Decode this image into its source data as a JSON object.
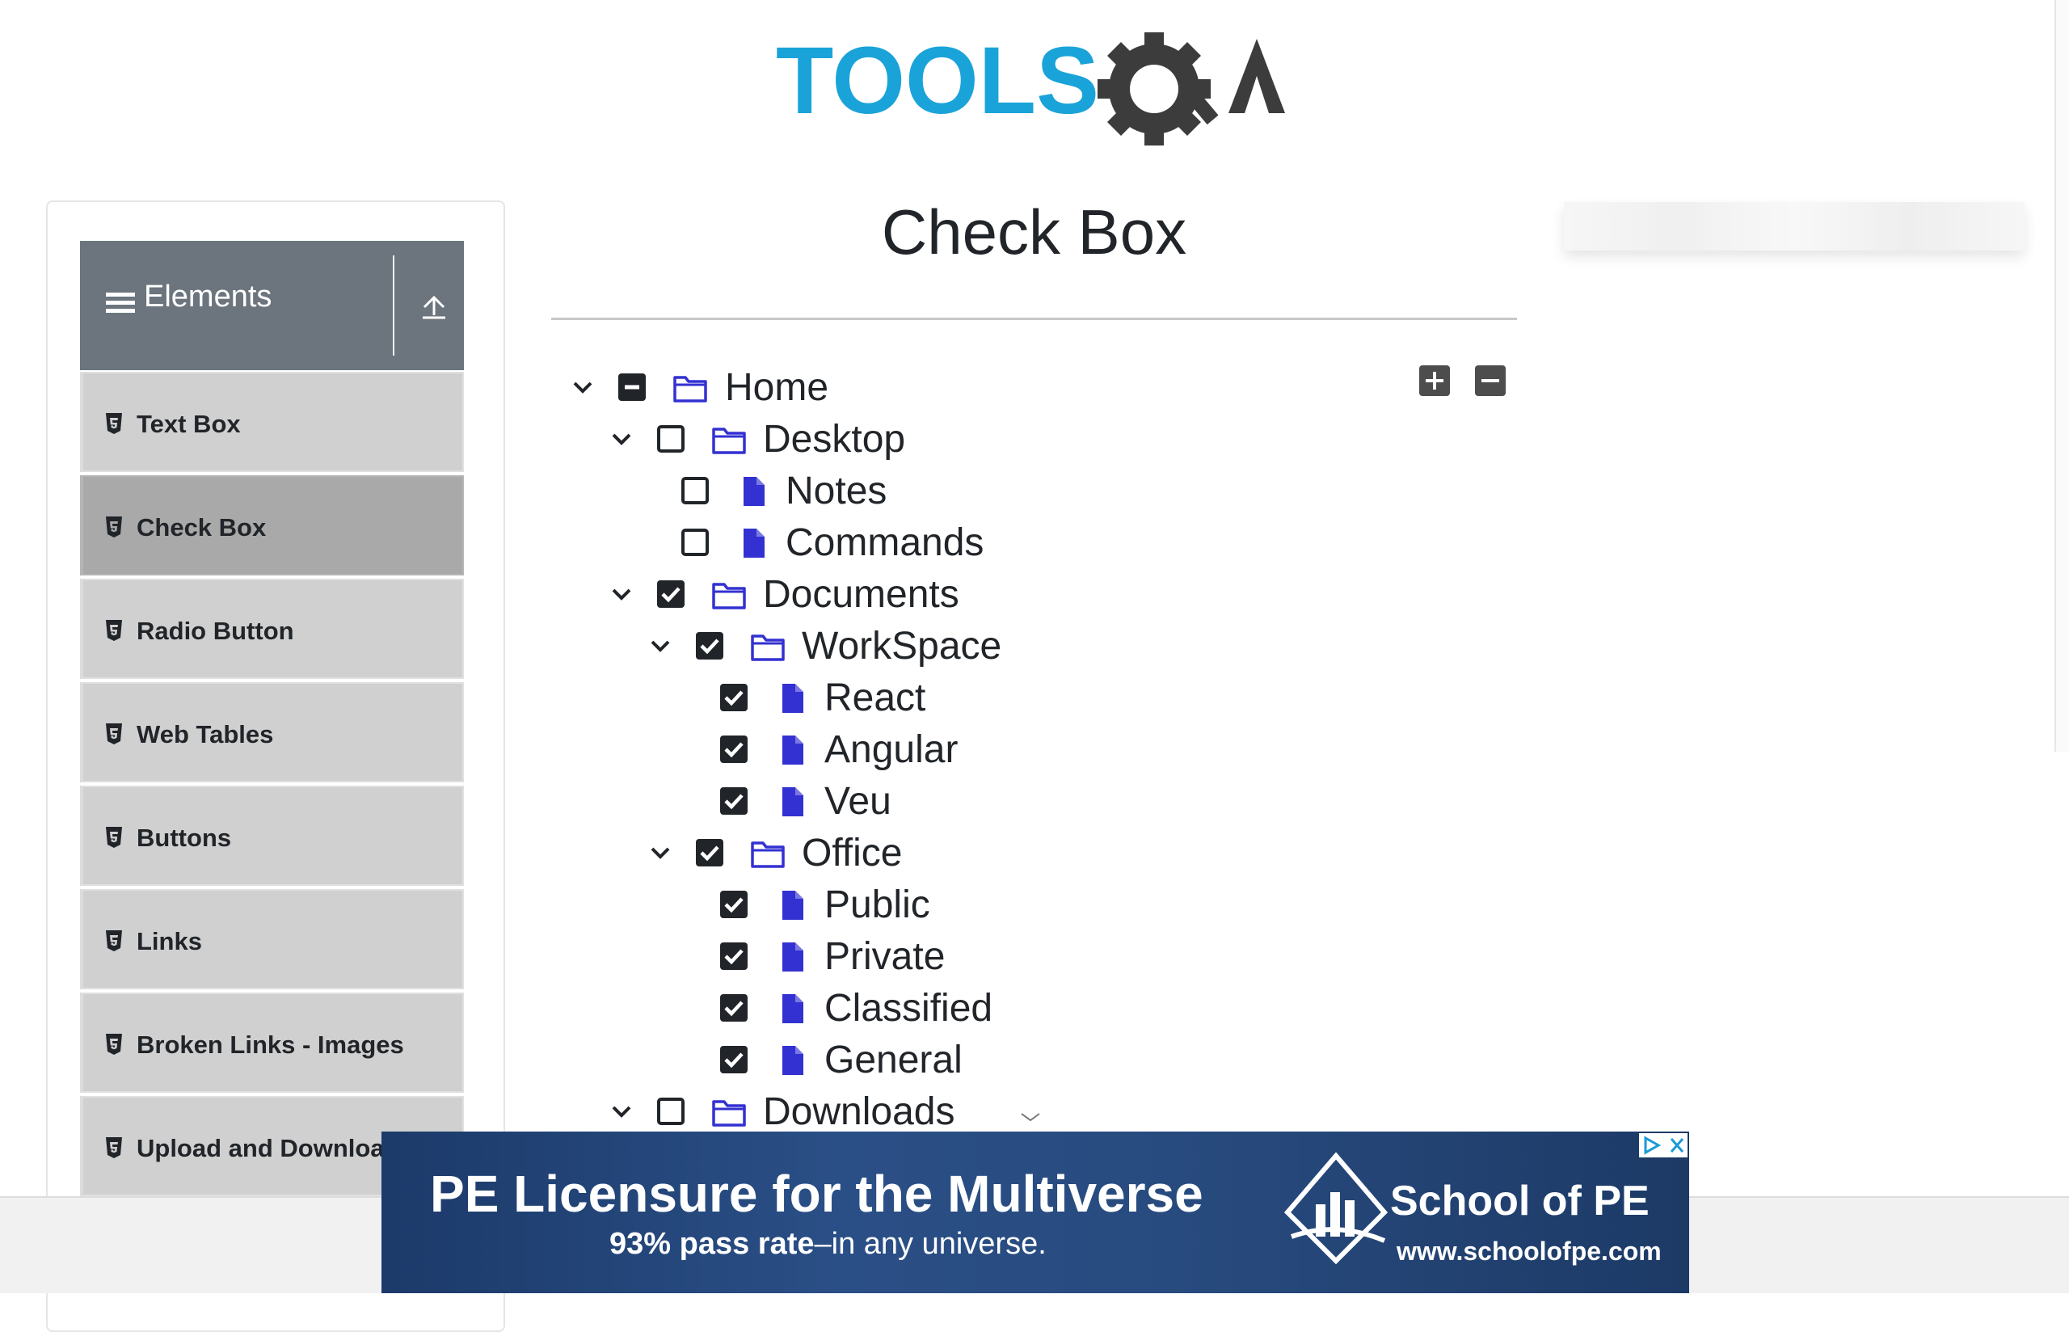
{
  "header": {
    "logo_alt": "TOOLSQA"
  },
  "sidebar": {
    "group_label": "Elements",
    "items": [
      {
        "label": "Text Box",
        "active": false
      },
      {
        "label": "Check Box",
        "active": true
      },
      {
        "label": "Radio Button",
        "active": false
      },
      {
        "label": "Web Tables",
        "active": false
      },
      {
        "label": "Buttons",
        "active": false
      },
      {
        "label": "Links",
        "active": false
      },
      {
        "label": "Broken Links - Images",
        "active": false
      },
      {
        "label": "Upload and Download",
        "active": false
      }
    ]
  },
  "main": {
    "title": "Check Box",
    "tree": [
      {
        "label": "Home",
        "state": "half",
        "type": "folder",
        "expanded": true
      },
      {
        "label": "Desktop",
        "state": "unchecked",
        "type": "folder",
        "expanded": true
      },
      {
        "label": "Notes",
        "state": "unchecked",
        "type": "file"
      },
      {
        "label": "Commands",
        "state": "unchecked",
        "type": "file"
      },
      {
        "label": "Documents",
        "state": "checked",
        "type": "folder",
        "expanded": true
      },
      {
        "label": "WorkSpace",
        "state": "checked",
        "type": "folder",
        "expanded": true
      },
      {
        "label": "React",
        "state": "checked",
        "type": "file"
      },
      {
        "label": "Angular",
        "state": "checked",
        "type": "file"
      },
      {
        "label": "Veu",
        "state": "checked",
        "type": "file"
      },
      {
        "label": "Office",
        "state": "checked",
        "type": "folder",
        "expanded": true
      },
      {
        "label": "Public",
        "state": "checked",
        "type": "file"
      },
      {
        "label": "Private",
        "state": "checked",
        "type": "file"
      },
      {
        "label": "Classified",
        "state": "checked",
        "type": "file"
      },
      {
        "label": "General",
        "state": "checked",
        "type": "file"
      },
      {
        "label": "Downloads",
        "state": "unchecked",
        "type": "folder",
        "expanded": true
      }
    ]
  },
  "ad": {
    "headline": "PE Licensure for the Multiverse",
    "sub_bold": "93% pass rate",
    "sub_rest": "–in any universe.",
    "brand": "School of PE",
    "url": "www.schoolofpe.com"
  },
  "colors": {
    "sidebar_header": "#6c757d",
    "menu_item": "#d0d0d0",
    "menu_item_active": "#a9a9a9",
    "tree_icon": "#3331d1",
    "logo_blue": "#1aa3d9",
    "logo_dark": "#3c3c3c"
  },
  "icons": {
    "menu": "hamburger-icon",
    "collapse": "upload-arrow-icon",
    "item": "html5-icon",
    "folder": "folder-outline-icon",
    "file": "file-icon",
    "toggle": "chevron-down-icon"
  }
}
